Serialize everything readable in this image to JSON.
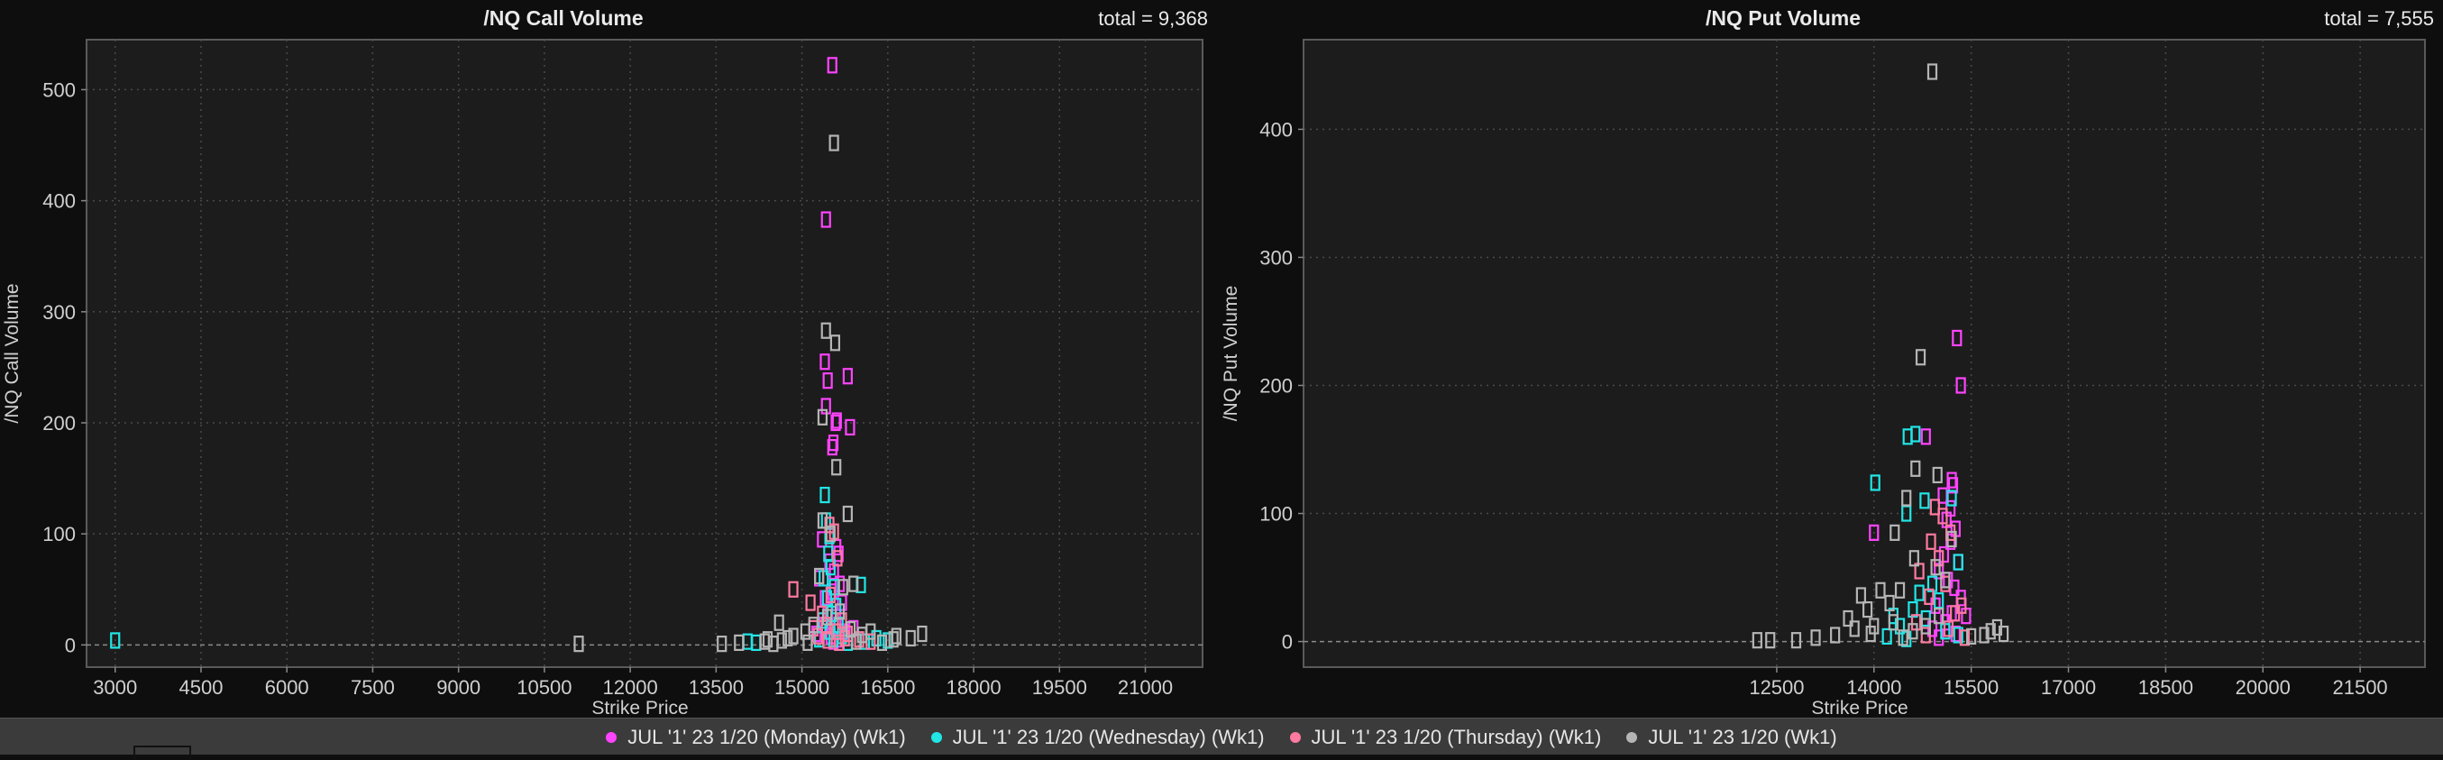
{
  "colors": {
    "monday": "#ff44ff",
    "wednesday": "#22e6e6",
    "thursday": "#ff7aa0",
    "wk1": "#b5b5b5",
    "plot_bg": "#1c1c1c",
    "page_bg": "#0e0e0e"
  },
  "legend": [
    {
      "label": "JUL '1' 23 1/20 (Monday) (Wk1)",
      "series": "monday"
    },
    {
      "label": "JUL '1' 23 1/20 (Wednesday) (Wk1)",
      "series": "wednesday"
    },
    {
      "label": "JUL '1' 23 1/20 (Thursday) (Wk1)",
      "series": "thursday"
    },
    {
      "label": "JUL '1' 23 1/20 (Wk1)",
      "series": "wk1"
    }
  ],
  "chart_data": [
    {
      "type": "scatter",
      "title": "/NQ Call Volume",
      "total_label": "total = 9,368",
      "xlabel": "Strike Price",
      "ylabel": "/NQ Call Volume",
      "xlim": [
        2500,
        22000
      ],
      "ylim": [
        -20,
        545
      ],
      "x_ticks": [
        3000,
        4500,
        6000,
        7500,
        9000,
        10500,
        12000,
        13500,
        15000,
        16500,
        18000,
        19500,
        21000
      ],
      "y_ticks": [
        0,
        100,
        200,
        300,
        400,
        500
      ],
      "grid": true,
      "series": [
        {
          "key": "monday",
          "points": [
            [
              15530,
              522
            ],
            [
              15420,
              383
            ],
            [
              15800,
              242
            ],
            [
              15840,
              196
            ],
            [
              15610,
              202
            ],
            [
              15590,
              200
            ],
            [
              15400,
              255
            ],
            [
              15450,
              238
            ],
            [
              15420,
              215
            ],
            [
              15550,
              182
            ],
            [
              15530,
              178
            ],
            [
              15350,
              95
            ],
            [
              15600,
              88
            ],
            [
              15640,
              82
            ],
            [
              15480,
              75
            ],
            [
              15560,
              66
            ],
            [
              15300,
              60
            ],
            [
              15660,
              55
            ],
            [
              15520,
              48
            ],
            [
              15400,
              42
            ],
            [
              15700,
              38
            ],
            [
              15450,
              30
            ],
            [
              15600,
              25
            ],
            [
              15380,
              18
            ],
            [
              15740,
              12
            ],
            [
              15500,
              8
            ],
            [
              15250,
              10
            ],
            [
              15650,
              5
            ],
            [
              15550,
              3
            ],
            [
              15900,
              15
            ]
          ]
        },
        {
          "key": "wednesday",
          "points": [
            [
              3000,
              4
            ],
            [
              15400,
              135
            ],
            [
              15420,
              112
            ],
            [
              15480,
              98
            ],
            [
              15460,
              82
            ],
            [
              15500,
              70
            ],
            [
              15380,
              60
            ],
            [
              15560,
              52
            ],
            [
              15440,
              42
            ],
            [
              15600,
              35
            ],
            [
              15520,
              28
            ],
            [
              15360,
              22
            ],
            [
              15640,
              18
            ],
            [
              16030,
              54
            ],
            [
              15480,
              12
            ],
            [
              15700,
              8
            ],
            [
              15300,
              5
            ],
            [
              16100,
              3
            ],
            [
              16300,
              6
            ],
            [
              14200,
              2
            ],
            [
              14050,
              3
            ],
            [
              15800,
              2
            ],
            [
              16500,
              4
            ],
            [
              15550,
              5
            ]
          ]
        },
        {
          "key": "thursday",
          "points": [
            [
              14850,
              50
            ],
            [
              15150,
              38
            ],
            [
              15480,
              108
            ],
            [
              15560,
              102
            ],
            [
              15620,
              78
            ],
            [
              15500,
              45
            ],
            [
              15350,
              28
            ],
            [
              15700,
              22
            ],
            [
              15420,
              18
            ],
            [
              15600,
              12
            ],
            [
              15280,
              8
            ],
            [
              15750,
              6
            ],
            [
              15450,
              4
            ],
            [
              15650,
              2
            ],
            [
              15800,
              10
            ],
            [
              16000,
              5
            ],
            [
              16200,
              3
            ],
            [
              15200,
              15
            ]
          ]
        },
        {
          "key": "wk1",
          "points": [
            [
              15560,
              452
            ],
            [
              15420,
              283
            ],
            [
              15580,
              272
            ],
            [
              15360,
              205
            ],
            [
              15600,
              160
            ],
            [
              15800,
              118
            ],
            [
              15360,
              112
            ],
            [
              15500,
              100
            ],
            [
              15900,
              55
            ],
            [
              15720,
              52
            ],
            [
              15300,
              62
            ],
            [
              15660,
              30
            ],
            [
              15440,
              25
            ],
            [
              15200,
              18
            ],
            [
              15060,
              12
            ],
            [
              14850,
              8
            ],
            [
              14600,
              20
            ],
            [
              14400,
              5
            ],
            [
              14350,
              3
            ],
            [
              13900,
              2
            ],
            [
              13600,
              1
            ],
            [
              11100,
              1
            ],
            [
              14650,
              4
            ],
            [
              15950,
              3
            ],
            [
              16400,
              2
            ],
            [
              16600,
              5
            ],
            [
              16650,
              8
            ],
            [
              16900,
              6
            ],
            [
              17100,
              10
            ],
            [
              16200,
              12
            ],
            [
              15100,
              2
            ],
            [
              14750,
              6
            ],
            [
              14500,
              1
            ],
            [
              15850,
              14
            ],
            [
              16050,
              9
            ]
          ]
        }
      ]
    },
    {
      "type": "scatter",
      "title": "/NQ Put Volume",
      "total_label": "total = 7,555",
      "xlabel": "Strike Price",
      "ylabel": "/NQ Put Volume",
      "xlim": [
        5200,
        22500
      ],
      "ylim": [
        -20,
        470
      ],
      "x_ticks": [
        12500,
        14000,
        15500,
        17000,
        18500,
        20000,
        21500
      ],
      "y_ticks": [
        0,
        100,
        200,
        300,
        400
      ],
      "grid": true,
      "series": [
        {
          "key": "monday",
          "points": [
            [
              15280,
              237
            ],
            [
              15340,
              200
            ],
            [
              14800,
              160
            ],
            [
              14000,
              85
            ],
            [
              15200,
              126
            ],
            [
              15220,
              122
            ],
            [
              15060,
              114
            ],
            [
              15180,
              104
            ],
            [
              15120,
              95
            ],
            [
              15260,
              88
            ],
            [
              15180,
              78
            ],
            [
              15080,
              68
            ],
            [
              15300,
              62
            ],
            [
              15000,
              55
            ],
            [
              15140,
              48
            ],
            [
              15240,
              42
            ],
            [
              15340,
              34
            ],
            [
              14950,
              28
            ],
            [
              15200,
              22
            ],
            [
              15420,
              20
            ],
            [
              15100,
              15
            ],
            [
              14900,
              10
            ],
            [
              15260,
              6
            ],
            [
              15000,
              3
            ]
          ]
        },
        {
          "key": "wednesday",
          "points": [
            [
              14020,
              124
            ],
            [
              14520,
              160
            ],
            [
              14640,
              162
            ],
            [
              14780,
              110
            ],
            [
              14500,
              100
            ],
            [
              15200,
              112
            ],
            [
              15300,
              62
            ],
            [
              14900,
              45
            ],
            [
              14700,
              38
            ],
            [
              15000,
              32
            ],
            [
              14600,
              25
            ],
            [
              14800,
              18
            ],
            [
              14400,
              12
            ],
            [
              15100,
              8
            ],
            [
              14200,
              4
            ],
            [
              14500,
              2
            ],
            [
              15300,
              5
            ],
            [
              14300,
              20
            ]
          ]
        },
        {
          "key": "thursday",
          "points": [
            [
              14940,
              105
            ],
            [
              15060,
              98
            ],
            [
              15180,
              85
            ],
            [
              15350,
              28
            ],
            [
              14880,
              78
            ],
            [
              15000,
              65
            ],
            [
              14700,
              55
            ],
            [
              15100,
              45
            ],
            [
              14850,
              35
            ],
            [
              15250,
              22
            ],
            [
              14650,
              15
            ],
            [
              15150,
              10
            ],
            [
              14800,
              5
            ],
            [
              15400,
              3
            ]
          ]
        },
        {
          "key": "wk1",
          "points": [
            [
              14900,
              445
            ],
            [
              14720,
              222
            ],
            [
              14640,
              135
            ],
            [
              14980,
              130
            ],
            [
              14500,
              112
            ],
            [
              14320,
              85
            ],
            [
              15200,
              80
            ],
            [
              14620,
              65
            ],
            [
              14400,
              40
            ],
            [
              14100,
              40
            ],
            [
              13800,
              36
            ],
            [
              14240,
              30
            ],
            [
              13900,
              25
            ],
            [
              14300,
              15
            ],
            [
              14000,
              12
            ],
            [
              13700,
              10
            ],
            [
              13400,
              5
            ],
            [
              13100,
              3
            ],
            [
              12800,
              1
            ],
            [
              12400,
              1
            ],
            [
              12200,
              1
            ],
            [
              15500,
              4
            ],
            [
              15700,
              5
            ],
            [
              15800,
              8
            ],
            [
              15900,
              11
            ],
            [
              16000,
              6
            ],
            [
              14600,
              8
            ],
            [
              14800,
              12
            ],
            [
              15000,
              20
            ],
            [
              14450,
              3
            ],
            [
              15100,
              48
            ],
            [
              14950,
              58
            ],
            [
              13600,
              18
            ],
            [
              13950,
              6
            ]
          ]
        }
      ]
    }
  ]
}
